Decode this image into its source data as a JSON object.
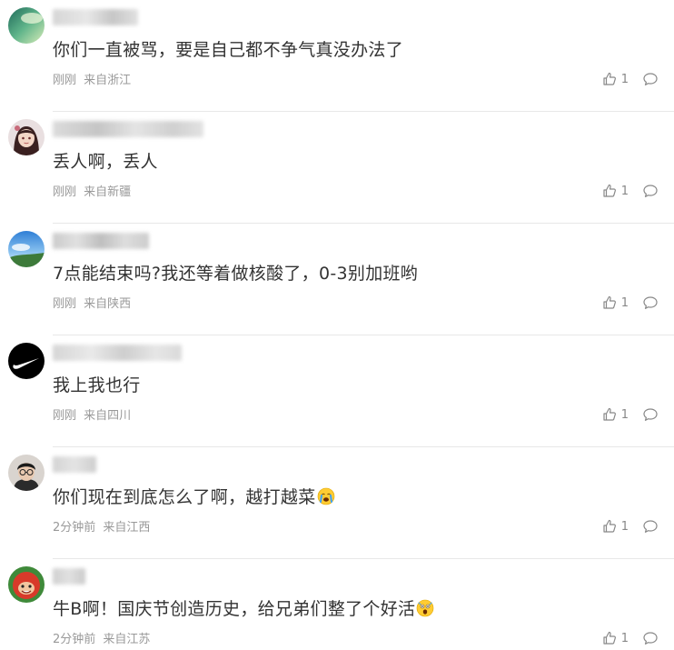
{
  "comments": [
    {
      "avatar_icon": "green-sky-avatar-icon",
      "text": "你们一直被骂，要是自己都不争气真没办法了",
      "time": "刚刚",
      "location": "来自浙江",
      "likes": "1"
    },
    {
      "avatar_icon": "anime-girl-avatar-icon",
      "text": "丢人啊，丢人",
      "time": "刚刚",
      "location": "来自新疆",
      "likes": "1"
    },
    {
      "avatar_icon": "blue-sky-landscape-avatar-icon",
      "text": "7点能结束吗?我还等着做核酸了，0-3别加班哟",
      "time": "刚刚",
      "location": "来自陕西",
      "likes": "1"
    },
    {
      "avatar_icon": "nike-swoosh-avatar-icon",
      "text": "我上我也行",
      "time": "刚刚",
      "location": "来自四川",
      "likes": "1"
    },
    {
      "avatar_icon": "person-with-glasses-avatar-icon",
      "text": "你们现在到底怎么了啊，越打越菜",
      "emoji": "crying-face-emoji-icon",
      "time": "2分钟前",
      "location": "来自江西",
      "likes": "1"
    },
    {
      "avatar_icon": "red-cartoon-avatar-icon",
      "text": "牛B啊！国庆节创造历史，给兄弟们整了个好活",
      "emoji": "shocked-face-emoji-icon",
      "time": "2分钟前",
      "location": "来自江苏",
      "likes": "1"
    }
  ],
  "icons": {
    "like": "thumbs-up-icon",
    "reply": "comment-bubble-icon"
  },
  "colors": {
    "text": "#333333",
    "meta": "#999999",
    "divider": "#e8e8e8"
  }
}
